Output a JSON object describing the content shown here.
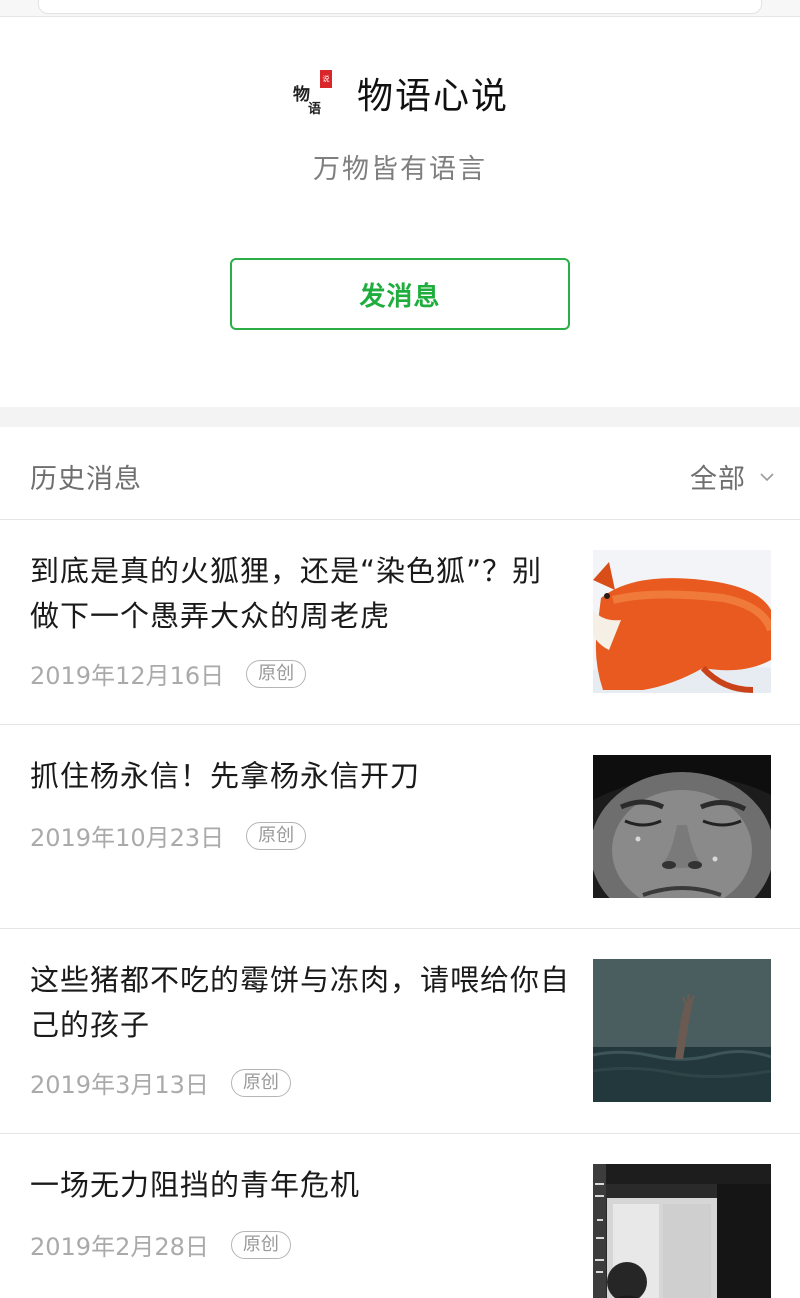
{
  "account": {
    "name": "物语心说",
    "slogan": "万物皆有语言",
    "logo_text": "物语",
    "send_button_label": "发消息"
  },
  "history": {
    "title": "历史消息",
    "filter_label": "全部"
  },
  "articles": [
    {
      "title": "到底是真的火狐狸，还是“染色狐”？别做下一个愚弄大众的周老虎",
      "date": "2019年12月16日",
      "badge": "原创",
      "thumbnail": "red-fox-in-snow"
    },
    {
      "title": "抓住杨永信！先拿杨永信开刀",
      "date": "2019年10月23日",
      "badge": "原创",
      "thumbnail": "crying-boy-face"
    },
    {
      "title": "这些猪都不吃的霉饼与冻肉，请喂给你自己的孩子",
      "date": "2019年3月13日",
      "badge": "原创",
      "thumbnail": "hand-rising-from-sea"
    },
    {
      "title": "一场无力阻挡的青年危机",
      "date": "2019年2月28日",
      "badge": "原创",
      "thumbnail": "person-by-window"
    }
  ],
  "colors": {
    "accent": "#1fae3e",
    "text": "#1a1a1a",
    "muted": "#aaaaaa",
    "divider": "#e5e5e5"
  }
}
